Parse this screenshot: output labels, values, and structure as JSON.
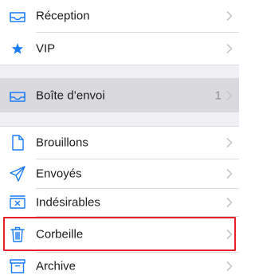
{
  "mailboxes": {
    "inbox": {
      "label": "Réception",
      "icon": "inbox-tray-icon"
    },
    "vip": {
      "label": "VIP",
      "icon": "star-icon"
    },
    "outbox": {
      "label": "Boîte d’envoi",
      "count": "1",
      "icon": "inbox-tray-icon"
    },
    "drafts": {
      "label": "Brouillons",
      "icon": "document-icon"
    },
    "sent": {
      "label": "Envoyés",
      "icon": "paper-plane-icon"
    },
    "junk": {
      "label": "Indésirables",
      "icon": "junk-box-icon"
    },
    "trash": {
      "label": "Corbeille",
      "icon": "trash-icon"
    },
    "archive": {
      "label": "Archive",
      "icon": "archive-box-icon"
    }
  },
  "colors": {
    "accent": "#1a7cf5",
    "highlight": "#e8202a",
    "group_background": "#efeff4",
    "selected_row": "#d9d9de"
  }
}
